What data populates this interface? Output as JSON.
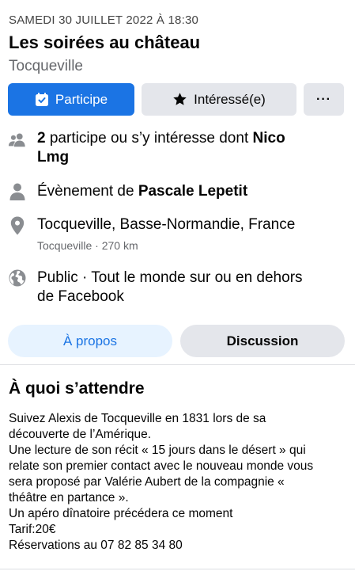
{
  "event": {
    "date": "SAMEDI 30 JUILLET 2022 À 18:30",
    "title": "Les soirées au château",
    "location_short": "Tocqueville"
  },
  "actions": {
    "participate": "Participe",
    "interested": "Intéressé(e)",
    "more": "···"
  },
  "details": {
    "attendance_count": "2",
    "attendance_text": " participe ou s’y intéresse dont ",
    "attendance_name_line1": "Nico",
    "attendance_name_line2": "Lmg",
    "organizer_prefix": "Évènement de ",
    "organizer_name": "Pascale Lepetit",
    "place": "Tocqueville, Basse-Normandie, France",
    "place_sub": "Tocqueville · 270 km",
    "privacy_line1": "Public · Tout le monde sur ou en dehors",
    "privacy_line2": "de Facebook"
  },
  "tabs": {
    "about": "À propos",
    "discussion": "Discussion"
  },
  "about": {
    "heading": "À quoi s’attendre",
    "lines": [
      "Suivez Alexis de Tocqueville en 1831 lors de sa",
      "découverte de l’Amérique.",
      "Une lecture de son récit « 15 jours dans le désert » qui",
      "relate son premier contact avec le nouveau monde vous",
      "sera proposé par Valérie Aubert de la compagnie «",
      "théâtre en partance ».",
      "Un apéro dînatoire précédera ce moment",
      "Tarif:20€",
      "Réservations au 07 82 85 34 80"
    ]
  },
  "colors": {
    "primary": "#1b74e4",
    "secondary_bg": "#e4e6eb",
    "tab_active_bg": "#e7f3ff",
    "muted_text": "#65676b",
    "icon_gray": "#8a8d91"
  }
}
